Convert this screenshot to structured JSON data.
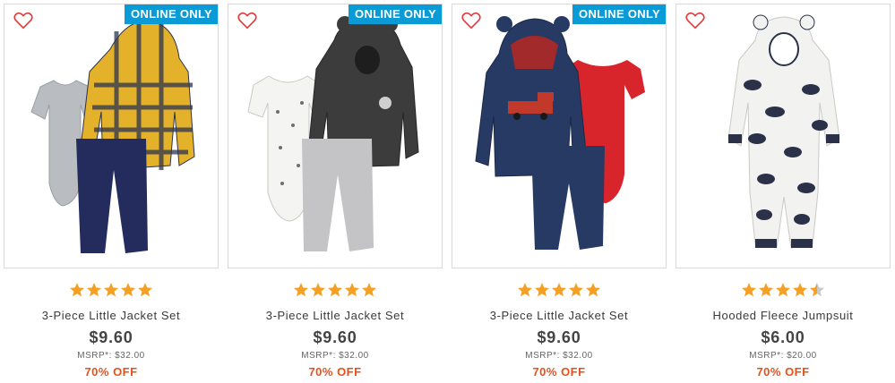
{
  "colors": {
    "star": "#f5a024",
    "star_empty": "#c9c9c9",
    "badge": "#0a9bd6",
    "discount": "#e8501a",
    "heart": "#e23a3a"
  },
  "products": [
    {
      "badge": "ONLINE ONLY",
      "rating": 5,
      "name": "3-Piece Little Jacket Set",
      "price": "$9.60",
      "msrp": "MSRP*: $32.00",
      "discount": "70% OFF",
      "favorite_icon": "heart-outline-icon"
    },
    {
      "badge": "ONLINE ONLY",
      "rating": 5,
      "name": "3-Piece Little Jacket Set",
      "price": "$9.60",
      "msrp": "MSRP*: $32.00",
      "discount": "70% OFF",
      "favorite_icon": "heart-outline-icon"
    },
    {
      "badge": "ONLINE ONLY",
      "rating": 5,
      "name": "3-Piece Little Jacket Set",
      "price": "$9.60",
      "msrp": "MSRP*: $32.00",
      "discount": "70% OFF",
      "favorite_icon": "heart-outline-icon"
    },
    {
      "badge": "",
      "rating": 4.5,
      "name": "Hooded Fleece Jumpsuit",
      "price": "$6.00",
      "msrp": "MSRP*: $20.00",
      "discount": "70% OFF",
      "favorite_icon": "heart-outline-icon"
    }
  ]
}
